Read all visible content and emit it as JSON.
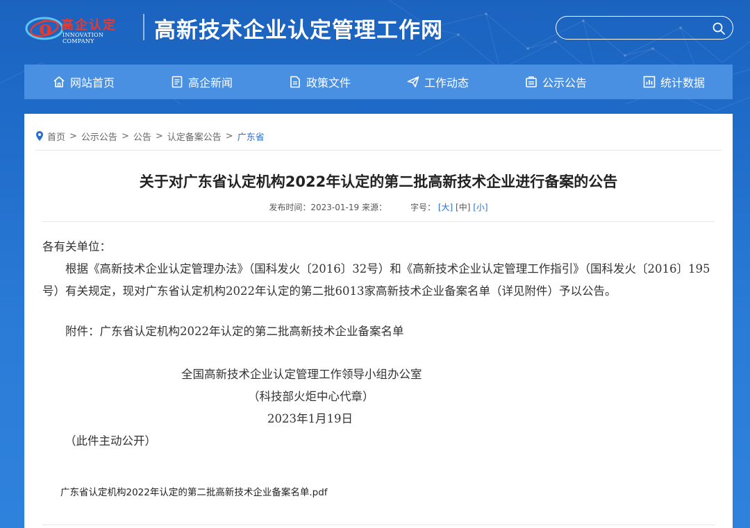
{
  "brand": {
    "logo_cn": "高企认定",
    "logo_en": "INNOVATION COMPANY",
    "site_title": "高新技术企业认定管理工作网",
    "red": "#e8392e"
  },
  "search": {
    "placeholder": "",
    "icon": "search-icon"
  },
  "nav": {
    "items": [
      {
        "label": "网站首页",
        "icon": "home-icon"
      },
      {
        "label": "高企新闻",
        "icon": "news-icon"
      },
      {
        "label": "政策文件",
        "icon": "document-icon"
      },
      {
        "label": "工作动态",
        "icon": "send-icon"
      },
      {
        "label": "公示公告",
        "icon": "announcement-icon"
      },
      {
        "label": "统计数据",
        "icon": "chart-icon"
      }
    ],
    "color": "#4a90e2"
  },
  "breadcrumb": {
    "items": [
      "首页",
      "公示公告",
      "公告",
      "认定备案公告",
      "广东省"
    ],
    "separator": ">"
  },
  "article": {
    "title": "关于对广东省认定机构2022年认定的第二批高新技术企业进行备案的公告",
    "meta_date": "发布时间：2023-01-19 来源：",
    "font_size_label": "字号：",
    "font_large": "[大]",
    "font_medium": "[中]",
    "font_small": "[小]",
    "salutation": "各有关单位：",
    "paragraph": "根据《高新技术企业认定管理办法》（国科发火〔2016〕32号）和《高新技术企业认定管理工作指引》（国科发火〔2016〕195号）有关规定，现对广东省认定机构2022年认定的第二批6013家高新技术企业备案名单（详见附件）予以公告。",
    "attachment": "附件：广东省认定机构2022年认定的第二批高新技术企业备案名单",
    "signature_org": "全国高新技术企业认定管理工作领导小组办公室",
    "signature_seal": "（科技部火炬中心代章）",
    "signature_date": "2023年1月19日",
    "public_note": "（此件主动公开）",
    "pdf_link": "广东省认定机构2022年认定的第二批高新技术企业备案名单.pdf"
  }
}
